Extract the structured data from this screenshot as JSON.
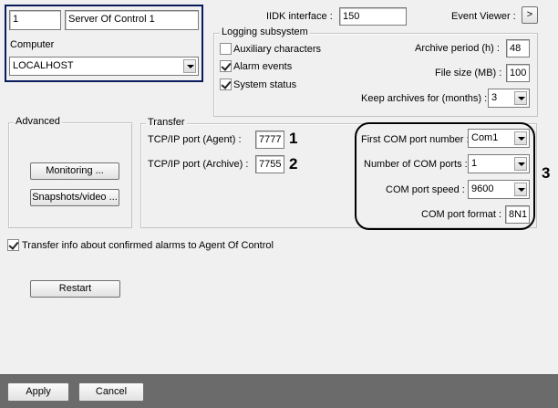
{
  "server": {
    "id": "1",
    "name": "Server Of Control 1",
    "computer_label": "Computer",
    "computer_value": "LOCALHOST"
  },
  "top": {
    "iidk_label": "IIDK interface :",
    "iidk_value": "150",
    "event_viewer_label": "Event Viewer :",
    "event_viewer_button": ">"
  },
  "logging": {
    "title": "Logging subsystem",
    "auxiliary_label": "Auxiliary characters",
    "auxiliary_checked": false,
    "alarm_label": "Alarm events",
    "alarm_checked": true,
    "status_label": "System status",
    "status_checked": true,
    "archive_period_label": "Archive period (h) :",
    "archive_period_value": "48",
    "file_size_label": "File size (MB) :",
    "file_size_value": "100",
    "keep_label": "Keep archives for (months) :",
    "keep_value": "3"
  },
  "advanced": {
    "title": "Advanced",
    "monitoring_button": "Monitoring ...",
    "snapshots_button": "Snapshots/video ..."
  },
  "transfer": {
    "title": "Transfer",
    "agent_label": "TCP/IP port (Agent) :",
    "agent_value": "7777",
    "archive_label": "TCP/IP port (Archive) :",
    "archive_value": "7755",
    "first_com_label": "First COM port number :",
    "first_com_value": "Com1",
    "num_com_label": "Number of COM ports :",
    "num_com_value": "1",
    "com_speed_label": "COM port speed :",
    "com_speed_value": "9600",
    "com_format_label": "COM port format :",
    "com_format_value": "8N1"
  },
  "annotations": {
    "one": "1",
    "two": "2",
    "three": "3"
  },
  "transfer_info": {
    "label": "Transfer info about confirmed alarms to Agent Of Control",
    "checked": true
  },
  "buttons": {
    "restart": "Restart",
    "apply": "Apply",
    "cancel": "Cancel"
  }
}
